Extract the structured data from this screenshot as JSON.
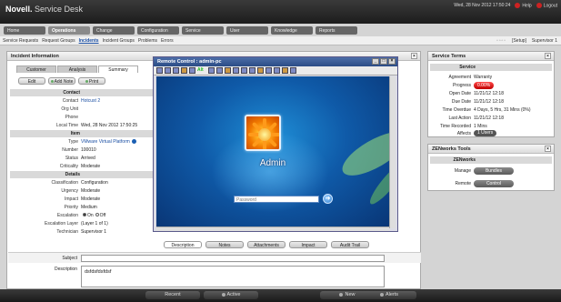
{
  "header": {
    "brand_novell": "Novell.",
    "brand_product": "Service Desk",
    "datetime": "Wed, 28 Nov 2012 17:50:24",
    "help": "Help",
    "logout": "Logout"
  },
  "nav": {
    "tabs": [
      {
        "label": "Home"
      },
      {
        "label": "Operations"
      },
      {
        "label": "Change"
      },
      {
        "label": "Configuration"
      },
      {
        "label": "Service"
      },
      {
        "label": "User"
      },
      {
        "label": "Knowledge"
      },
      {
        "label": "Reports"
      }
    ],
    "subnav": [
      {
        "label": "Service Requests"
      },
      {
        "label": "Request Groups"
      },
      {
        "label": "Incidents"
      },
      {
        "label": "Incident Groups"
      },
      {
        "label": "Problems"
      },
      {
        "label": "Errors"
      }
    ],
    "setup": "[Setup]",
    "user": "Supervisor 1"
  },
  "incident": {
    "title": "Incident Information",
    "tabs": [
      "Customer",
      "Analysis",
      "Summary"
    ],
    "actions": {
      "edit": "Edit",
      "add_note": "Add Note",
      "print": "Print"
    },
    "contact": {
      "header": "Contact",
      "contact_label": "Contact",
      "contact_value": "Hotcust 2",
      "org_label": "Org Unit",
      "phone_label": "Phone",
      "localtime_label": "Local Time",
      "localtime_value": "Wed, 28 Nov 2012 17:50:25"
    },
    "item": {
      "header": "Item",
      "type_label": "Type",
      "type_value": "VMware Virtual Platform",
      "number_label": "Number",
      "number_value": "100010",
      "status_label": "Status",
      "status_value": "Arrived",
      "criticality_label": "Criticality",
      "criticality_value": "Moderate"
    },
    "details": {
      "header": "Details",
      "classification_label": "Classification",
      "classification_value": "Configuration",
      "urgency_label": "Urgency",
      "urgency_value": "Moderate",
      "impact_label": "Impact",
      "impact_value": "Moderate",
      "priority_label": "Priority",
      "priority_value": "Medium",
      "escalation_label": "Escalation",
      "escalation_on": "On",
      "escalation_off": "Off",
      "escalation_layer_label": "Escalation Layer",
      "escalation_layer_value": "(Layer 1 of 1)",
      "technician_label": "Technician",
      "technician_value": "Supervisor 1"
    },
    "bottom_tabs": [
      "Description",
      "Notes",
      "Attachments",
      "Impact",
      "Audit Trail"
    ],
    "subject_label": "Subject",
    "subject_value": "",
    "description_label": "Description",
    "description_value": "dsfdsfdsfdsf"
  },
  "remote": {
    "title": "Remote Control : admin-pc",
    "toolbar_alt": "Alt",
    "username": "Admin",
    "password_placeholder": "Password",
    "go_symbol": "➜"
  },
  "service_terms": {
    "title": "Service Terms",
    "header": "Service",
    "agreement_label": "Agreement",
    "agreement_value": "Warranty",
    "progress_label": "Progress",
    "progress_value": "0.00%",
    "progress_fraction": 1.0,
    "open_label": "Open Date",
    "open_value": "11/21/12 12:18",
    "due_label": "Due Date",
    "due_value": "11/21/12 12:18",
    "overdue_label": "Time Overdue",
    "overdue_value": "4 Days, 5 Hrs, 31 Mins (0%)",
    "lastaction_label": "Last Action",
    "lastaction_value": "11/21/12 12:18",
    "recorded_label": "Time Recorded",
    "recorded_value": "1 Mins",
    "affects_label": "Affects",
    "affects_value": "1 Users"
  },
  "zenworks": {
    "title": "ZENworks Tools",
    "header": "ZENworks",
    "manage_label": "Manage",
    "manage_button": "Bundles",
    "remote_label": "Remote",
    "remote_button": "Control"
  },
  "footer": {
    "recent": "Recent",
    "active": "Active",
    "new": "New",
    "alerts": "Alerts"
  },
  "colors": {
    "progress_bar": "#d40000",
    "link": "#1b4fa3",
    "header_bg": "#222222"
  }
}
